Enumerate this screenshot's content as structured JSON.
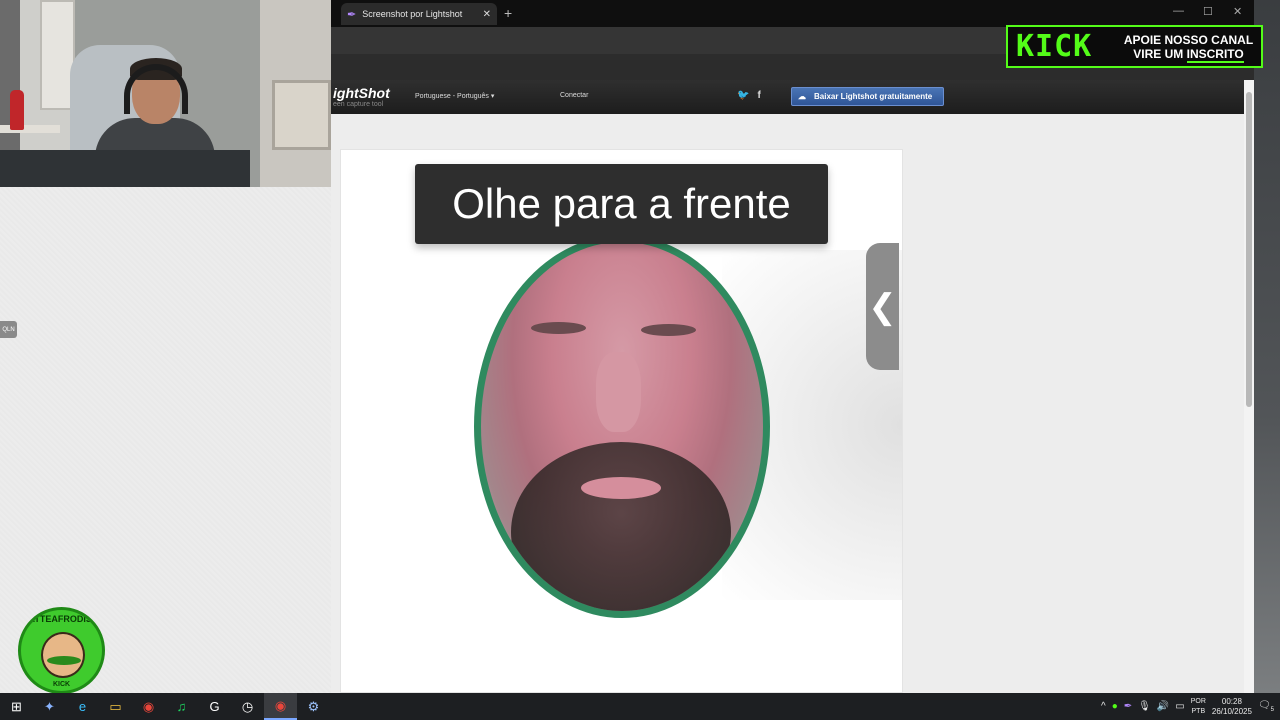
{
  "browser": {
    "tab_title": "Screenshot por Lightshot",
    "new_tab_glyph": "+",
    "close_glyph": "✕",
    "minimize_glyph": "—",
    "maximize_glyph": "☐",
    "window_close_glyph": "✕"
  },
  "lightshot": {
    "logo": "ightShot",
    "tagline": "een capture tool",
    "language": "Portuguese - Português",
    "connect": "Conectar",
    "social_twitter": "🐦",
    "social_facebook": "f",
    "download_button": "Baixar Lightshot gratuitamente",
    "download_icon": "cloud-download-icon"
  },
  "screenshot": {
    "prompt": "Olhe para a frente",
    "side_handle": "❮",
    "oval_border_color": "#2f8a5f"
  },
  "kick_banner": {
    "logo": "KICK",
    "line1": "APOIE NOSSO CANAL",
    "line2_prefix": "VIRE UM ",
    "line2_underlined": "INSCRITO",
    "accent": "#53fc18"
  },
  "overlay": {
    "qln": "QLN",
    "badge_ring": "MATTEAFRODISIACO",
    "badge_bottom": "KICK"
  },
  "taskbar": {
    "icons": [
      "windows-start-icon",
      "copilot-icon",
      "edge-icon",
      "file-explorer-icon",
      "chrome-icon",
      "spotify-icon",
      "logitech-g-icon",
      "clock-app-icon",
      "chrome-active-icon",
      "steam-icon"
    ],
    "glyphs": [
      "⊞",
      "✦",
      "e",
      "▭",
      "◉",
      "♫",
      "G",
      "◷",
      "◉",
      "⚙"
    ],
    "tray_caret": "^",
    "lang_line1": "POR",
    "lang_line2": "PTB",
    "time": "00:28",
    "date": "26/10/2025",
    "notifications": "5"
  }
}
